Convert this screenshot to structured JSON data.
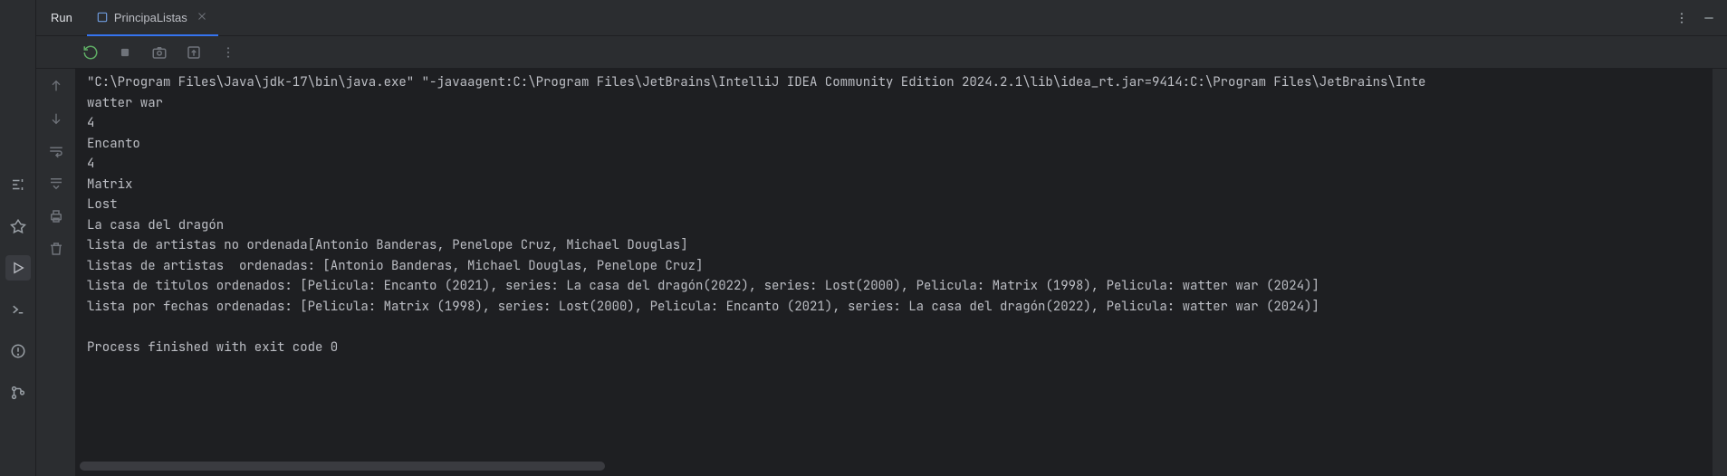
{
  "sidebar": {
    "icons": [
      "structure",
      "services",
      "run",
      "terminal",
      "problems",
      "git"
    ]
  },
  "tabs": {
    "panelTitle": "Run",
    "fileName": "PrincipaListas"
  },
  "toolbar": {
    "icons": [
      "rerun",
      "stop",
      "camera",
      "export",
      "more"
    ]
  },
  "gutter": {
    "icons": [
      "up",
      "down",
      "wrap",
      "scroll",
      "print",
      "trash"
    ]
  },
  "console": {
    "lines": [
      "\"C:\\Program Files\\Java\\jdk-17\\bin\\java.exe\" \"-javaagent:C:\\Program Files\\JetBrains\\IntelliJ IDEA Community Edition 2024.2.1\\lib\\idea_rt.jar=9414:C:\\Program Files\\JetBrains\\Inte",
      "watter war",
      "4",
      "Encanto",
      "4",
      "Matrix",
      "Lost",
      "La casa del dragón",
      "lista de artistas no ordenada[Antonio Banderas, Penelope Cruz, Michael Douglas]",
      "listas de artistas  ordenadas: [Antonio Banderas, Michael Douglas, Penelope Cruz]",
      "lista de titulos ordenados: [Pelicula: Encanto (2021), series: La casa del dragón(2022), series: Lost(2000), Pelicula: Matrix (1998), Pelicula: watter war (2024)]",
      "lista por fechas ordenadas: [Pelicula: Matrix (1998), series: Lost(2000), Pelicula: Encanto (2021), series: La casa del dragón(2022), Pelicula: watter war (2024)]",
      "",
      "Process finished with exit code 0"
    ]
  }
}
